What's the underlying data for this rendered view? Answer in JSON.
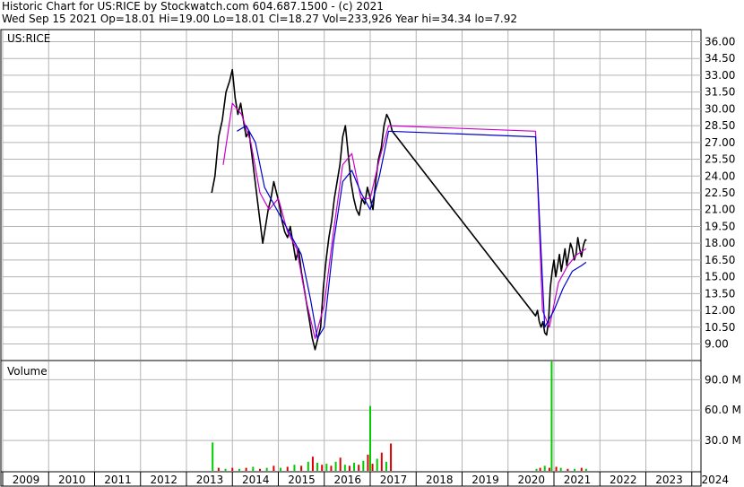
{
  "header": {
    "line1": "Historic Chart for US:RICE by Stockwatch.com 604.687.1500 - (c) 2021",
    "line2": "Wed Sep 15 2021   Op=18.01   Hi=19.00   Lo=18.01   Cl=18.27   Vol=233,926   Year hi=34.34   lo=7.92"
  },
  "chart_data": [
    {
      "type": "line",
      "title": "US:RICE",
      "y_ticks": [
        9.0,
        10.5,
        12.0,
        13.5,
        15.0,
        16.5,
        18.0,
        19.5,
        21.0,
        22.5,
        24.0,
        25.5,
        27.0,
        28.5,
        30.0,
        31.5,
        33.0,
        34.5,
        36.0
      ],
      "y_tick_labels": [
        "9.00",
        "10.50",
        "12.00",
        "13.50",
        "15.00",
        "16.50",
        "18.00",
        "19.50",
        "21.00",
        "22.50",
        "24.00",
        "25.50",
        "27.00",
        "28.50",
        "30.00",
        "31.50",
        "33.00",
        "34.50",
        "36.00"
      ],
      "ylim": [
        7.6,
        37.0
      ],
      "x_ticks": [
        "2009",
        "2010",
        "2011",
        "2012",
        "2013",
        "2014",
        "2015",
        "2016",
        "2017",
        "2018",
        "2019",
        "2020",
        "2021",
        "2022",
        "2023",
        "2024"
      ],
      "xlim": [
        2009.0,
        2024.2
      ],
      "grid": true,
      "colors": {
        "price": "#000000",
        "ma_short": "#cc00cc",
        "ma_long": "#0000cc"
      },
      "series": [
        {
          "x": [
            2013.55,
            2013.62,
            2013.7,
            2013.78,
            2013.86,
            2013.94,
            2014.0,
            2014.06,
            2014.12,
            2014.18,
            2014.24,
            2014.3,
            2014.36,
            2014.42,
            2014.48,
            2014.54,
            2014.6,
            2014.66,
            2014.72,
            2014.78,
            2014.84,
            2014.9,
            2014.96,
            2015.02,
            2015.08,
            2015.14,
            2015.2,
            2015.26,
            2015.32,
            2015.38,
            2015.44,
            2015.5,
            2015.56,
            2015.62,
            2015.68,
            2015.74,
            2015.8,
            2015.86,
            2015.92,
            2015.98,
            2016.04,
            2016.1,
            2016.16,
            2016.22,
            2016.28,
            2016.34,
            2016.4,
            2016.46,
            2016.52,
            2016.58,
            2016.64,
            2016.7,
            2016.76,
            2016.82,
            2016.88,
            2016.94,
            2017.0,
            2017.06,
            2017.12,
            2017.18,
            2017.24,
            2017.3,
            2017.36,
            2017.42,
            2017.48,
            2020.6,
            2020.64,
            2020.68,
            2020.72,
            2020.76,
            2020.8,
            2020.84,
            2020.88,
            2020.92,
            2020.96,
            2021.0,
            2021.04,
            2021.08,
            2021.12,
            2021.16,
            2021.2,
            2021.24,
            2021.28,
            2021.32,
            2021.36,
            2021.4,
            2021.44,
            2021.48,
            2021.52,
            2021.56,
            2021.6,
            2021.64,
            2021.68,
            2021.71
          ],
          "values": [
            22.5,
            24.0,
            27.5,
            29.0,
            31.5,
            32.5,
            33.5,
            31.0,
            29.5,
            30.5,
            29.0,
            27.5,
            28.0,
            26.0,
            24.0,
            22.0,
            20.0,
            18.0,
            19.5,
            21.0,
            22.0,
            23.5,
            22.5,
            21.5,
            20.0,
            19.0,
            18.5,
            19.5,
            18.0,
            16.5,
            17.5,
            15.5,
            14.0,
            12.5,
            11.0,
            9.5,
            8.5,
            9.5,
            10.5,
            14.0,
            16.5,
            18.5,
            20.0,
            22.0,
            23.5,
            25.0,
            27.5,
            28.5,
            26.0,
            23.5,
            22.0,
            21.0,
            20.5,
            22.0,
            21.5,
            23.0,
            22.0,
            21.0,
            23.5,
            25.5,
            26.5,
            28.5,
            29.5,
            29.0,
            28.0,
            11.5,
            12.0,
            11.0,
            10.5,
            11.0,
            10.0,
            9.8,
            11.0,
            14.0,
            15.5,
            16.5,
            15.0,
            16.0,
            17.0,
            15.5,
            16.5,
            17.5,
            16.0,
            17.0,
            18.0,
            17.5,
            16.5,
            17.0,
            18.5,
            17.5,
            16.8,
            17.8,
            18.3,
            18.27
          ]
        },
        {
          "x": [
            2013.8,
            2014.0,
            2014.2,
            2014.4,
            2014.6,
            2014.8,
            2015.0,
            2015.2,
            2015.4,
            2015.6,
            2015.8,
            2016.0,
            2016.2,
            2016.4,
            2016.6,
            2016.8,
            2017.0,
            2017.2,
            2017.4,
            2020.6,
            2020.75,
            2020.9,
            2021.1,
            2021.3,
            2021.5,
            2021.7
          ],
          "values": [
            25.0,
            30.5,
            29.5,
            27.0,
            22.5,
            21.0,
            22.0,
            19.0,
            17.5,
            13.0,
            9.5,
            12.5,
            19.0,
            25.0,
            26.0,
            22.0,
            22.0,
            25.5,
            28.5,
            28.0,
            12.0,
            10.5,
            14.5,
            16.0,
            17.0,
            17.5
          ]
        },
        {
          "x": [
            2014.1,
            2014.3,
            2014.5,
            2014.7,
            2014.9,
            2015.1,
            2015.3,
            2015.5,
            2015.7,
            2015.85,
            2016.0,
            2016.2,
            2016.4,
            2016.6,
            2016.8,
            2017.0,
            2017.2,
            2017.4,
            2020.6,
            2020.8,
            2021.0,
            2021.2,
            2021.4,
            2021.6,
            2021.7
          ],
          "values": [
            28.0,
            28.5,
            27.0,
            23.0,
            21.5,
            20.0,
            18.5,
            17.0,
            13.0,
            9.5,
            10.5,
            18.0,
            23.5,
            24.5,
            22.5,
            21.0,
            24.0,
            28.0,
            27.5,
            10.5,
            12.0,
            14.0,
            15.5,
            16.0,
            16.3
          ]
        }
      ]
    },
    {
      "type": "bar",
      "title": "Volume",
      "y_ticks": [
        30,
        60,
        90
      ],
      "y_tick_labels": [
        "30.0 M",
        "60.0 M",
        "90.0 M"
      ],
      "ylim": [
        0,
        108
      ],
      "x": [
        2013.57,
        2013.7,
        2013.85,
        2014.0,
        2014.15,
        2014.3,
        2014.45,
        2014.6,
        2014.75,
        2014.9,
        2015.05,
        2015.2,
        2015.35,
        2015.5,
        2015.65,
        2015.75,
        2015.85,
        2015.95,
        2016.05,
        2016.15,
        2016.25,
        2016.35,
        2016.45,
        2016.55,
        2016.65,
        2016.75,
        2016.85,
        2016.95,
        2017.0,
        2017.05,
        2017.15,
        2017.25,
        2017.35,
        2017.45,
        2020.62,
        2020.7,
        2020.8,
        2020.9,
        2020.95,
        2021.05,
        2021.15,
        2021.3,
        2021.45,
        2021.6,
        2021.7
      ],
      "values": [
        28,
        3,
        2,
        3,
        2,
        3,
        4,
        2,
        3,
        5,
        3,
        4,
        6,
        5,
        9,
        14,
        8,
        6,
        7,
        5,
        9,
        13,
        6,
        5,
        8,
        6,
        10,
        16,
        64,
        7,
        12,
        18,
        9,
        27,
        2,
        3,
        5,
        3,
        110,
        4,
        3,
        2,
        2,
        3,
        2
      ],
      "up": [
        true,
        false,
        true,
        false,
        true,
        false,
        true,
        false,
        true,
        false,
        true,
        false,
        true,
        false,
        true,
        false,
        true,
        false,
        true,
        false,
        true,
        false,
        true,
        false,
        true,
        false,
        true,
        false,
        true,
        false,
        true,
        false,
        true,
        false,
        true,
        false,
        true,
        false,
        true,
        false,
        true,
        false,
        true,
        false,
        true
      ]
    }
  ]
}
